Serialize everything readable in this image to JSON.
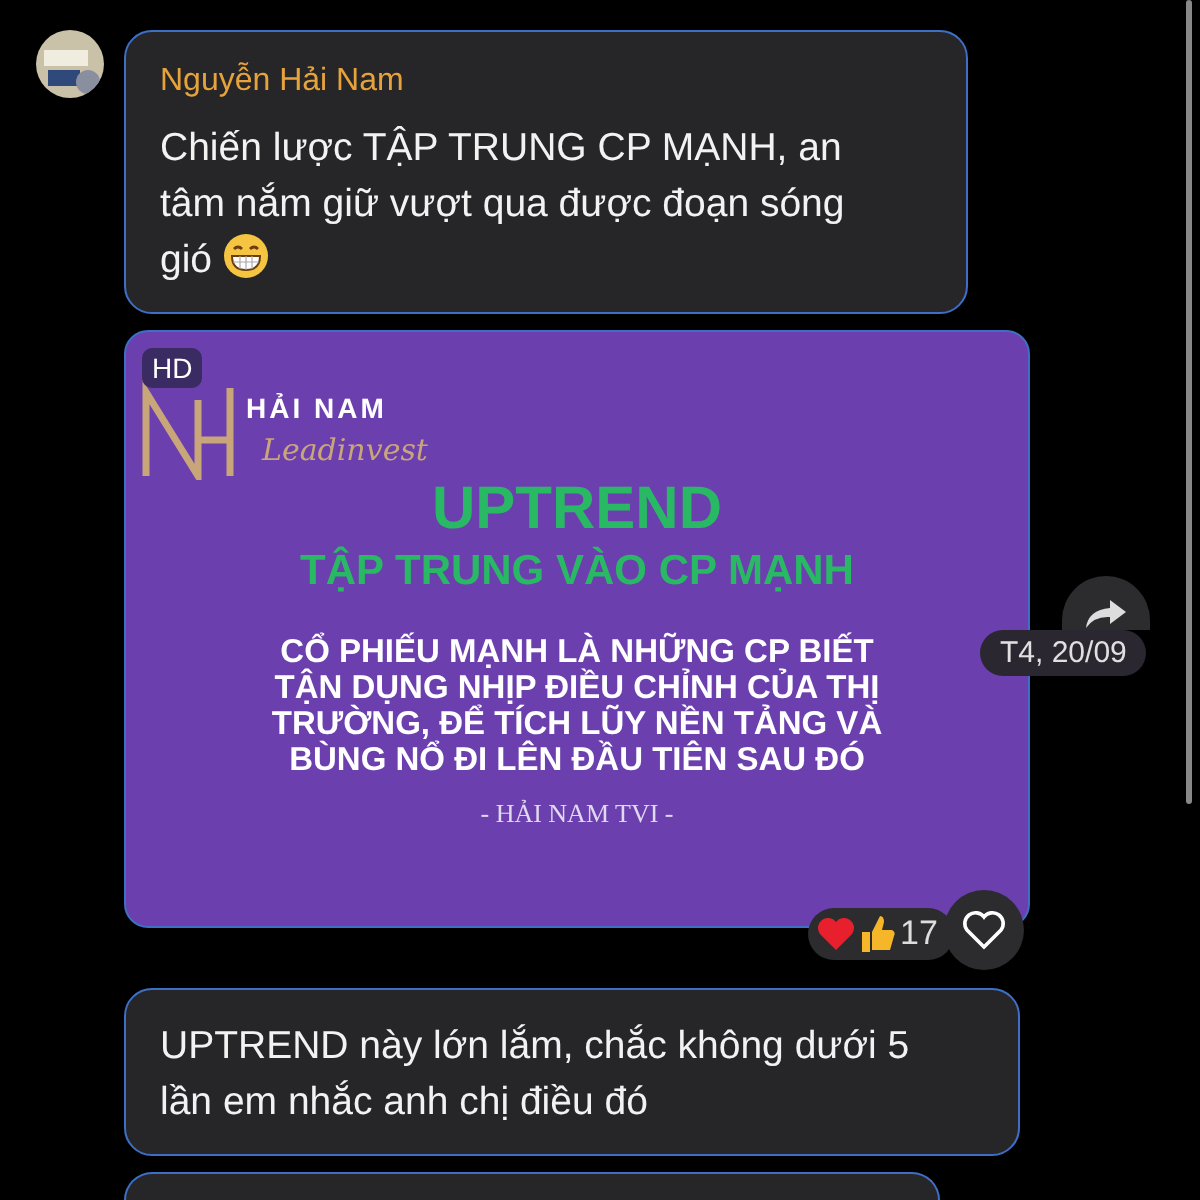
{
  "messages": [
    {
      "kind": "text",
      "sender": "Nguyễn Hải Nam",
      "avatar": true,
      "text": "Chiến lược TẬP TRUNG CP MẠNH, an tâm nắm giữ vượt qua được đoạn sóng gió",
      "emoji": true
    },
    {
      "kind": "image",
      "badge": "HD",
      "brand": "HẢI NAM",
      "brand_tagline": "Leadinvest",
      "headline": "UPTREND",
      "subheadline": "TẬP TRUNG VÀO CP MẠNH",
      "body_lines": [
        "CỔ PHIẾU MẠNH LÀ NHỮNG CP BIẾT",
        "TẬN DỤNG NHỊP ĐIỀU CHỈNH CỦA THỊ",
        "TRƯỜNG, ĐỂ TÍCH LŨY NỀN TẢNG VÀ",
        "BÙNG NỔ ĐI LÊN ĐẦU TIÊN SAU ĐÓ"
      ],
      "signature": "- HẢI NAM TVI -",
      "reaction_count": "17",
      "timestamp": "T4, 20/09"
    },
    {
      "kind": "text",
      "text": "UPTREND này lớn lắm, chắc không dưới 5 lần em nhắc anh chị điều đó"
    },
    {
      "kind": "stub"
    }
  ]
}
